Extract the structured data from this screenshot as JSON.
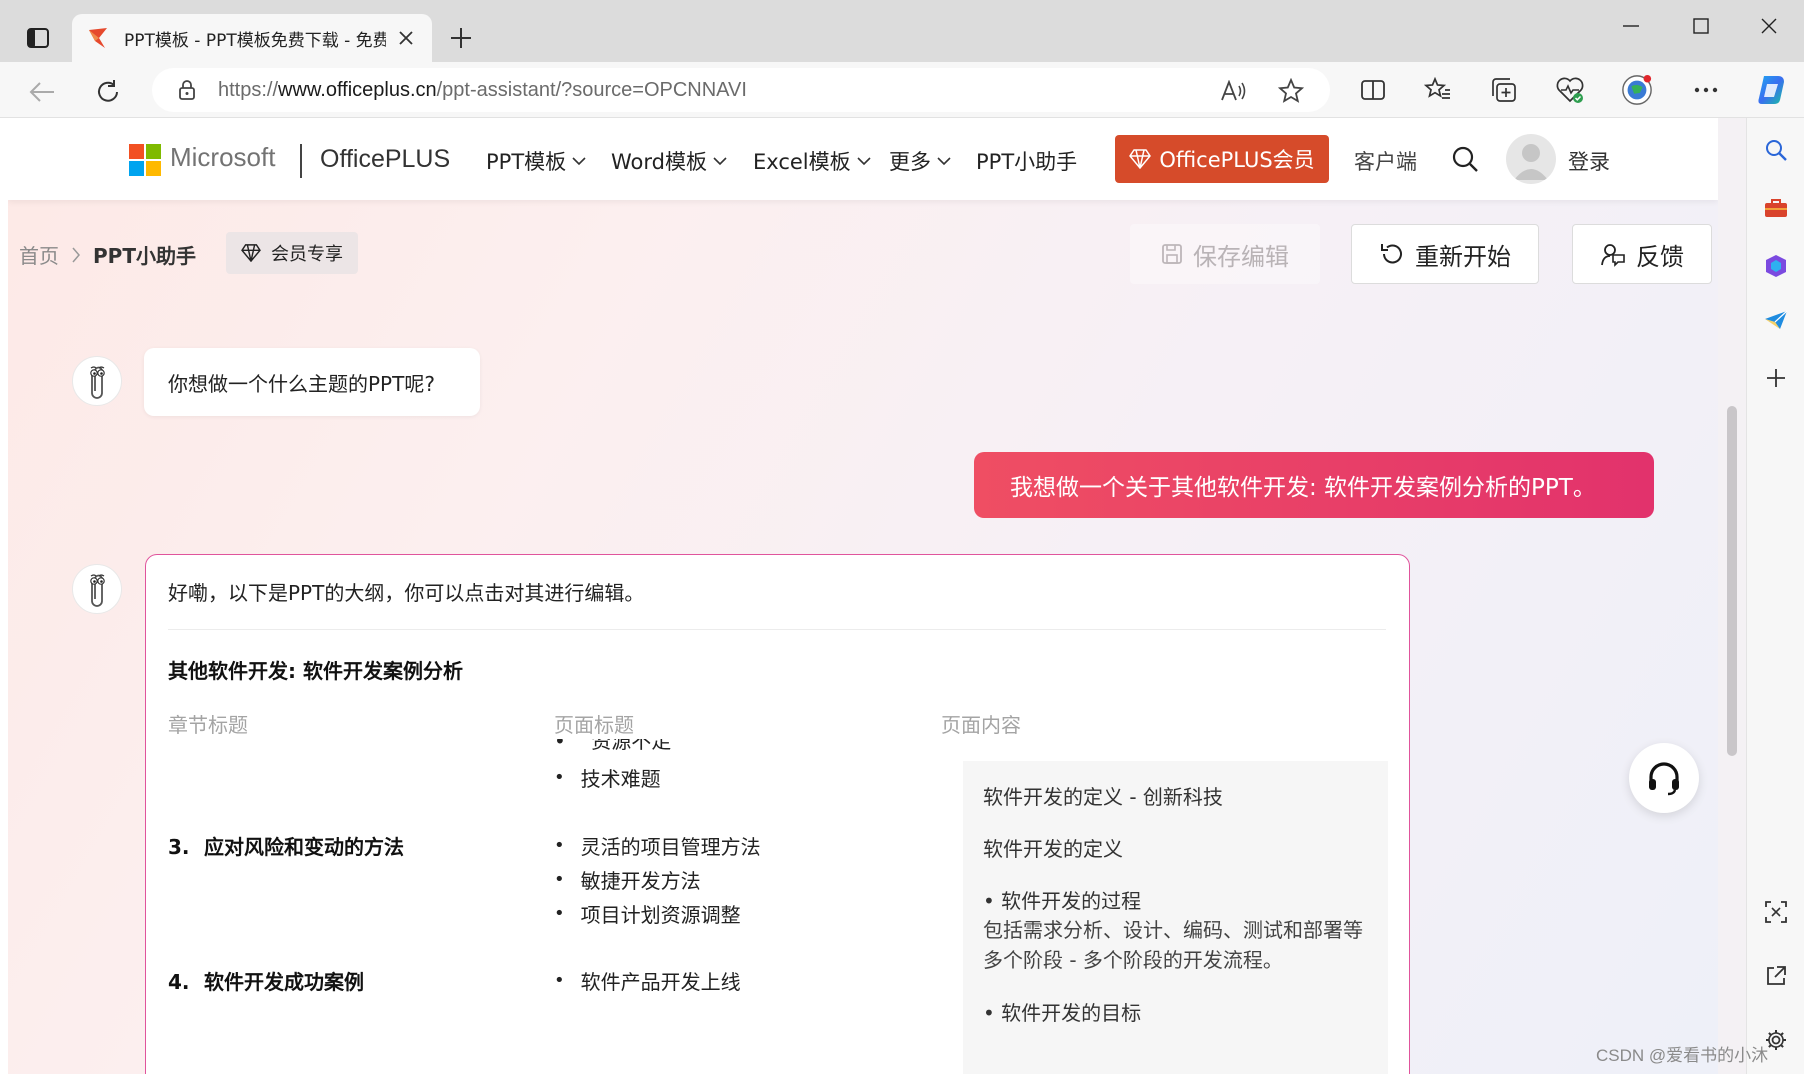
{
  "browser": {
    "tab_title": "PPT模板 - PPT模板免费下载 - 免费",
    "url_prefix": "https://",
    "url_host": "www.officeplus.cn",
    "url_path": "/ppt-assistant/?source=OPCNNAVI"
  },
  "header": {
    "brand_microsoft": "Microsoft",
    "brand_officeplus": "OfficePLUS",
    "nav": [
      "PPT模板",
      "Word模板",
      "Excel模板",
      "更多",
      "PPT小助手"
    ],
    "vip_label": "OfficePLUS会员",
    "client_label": "客户端",
    "login_label": "登录"
  },
  "breadcrumb": {
    "home": "首页",
    "current": "PPT小助手",
    "member_tag": "会员专享"
  },
  "actions": {
    "save": "保存编辑",
    "restart": "重新开始",
    "feedback": "反馈"
  },
  "chat": {
    "bot_question": "你想做一个什么主题的PPT呢?",
    "user_message": "我想做一个关于其他软件开发: 软件开发案例分析的PPT。",
    "bot_reply": "好嘞，以下是PPT的大纲，你可以点击对其进行编辑。"
  },
  "outline": {
    "title": "其他软件开发: 软件开发案例分析",
    "columns": [
      "章节标题",
      "页面标题",
      "页面内容"
    ],
    "cut_item": "资源不足",
    "prev_items": [
      "技术难题"
    ],
    "sections": [
      {
        "num": "3.",
        "title": "应对风险和变动的方法",
        "items": [
          "灵活的项目管理方法",
          "敏捷开发方法",
          "项目计划资源调整"
        ]
      },
      {
        "num": "4.",
        "title": "软件开发成功案例",
        "items": [
          "软件产品开发上线"
        ]
      }
    ],
    "content": {
      "heading": "软件开发的定义 - 创新科技",
      "sub": "软件开发的定义",
      "point1": "• 软件开发的过程",
      "para1": "包括需求分析、设计、编码、测试和部署等多个阶段 - 多个阶段的开发流程。",
      "point2": "• 软件开发的目标"
    }
  },
  "watermark": "CSDN @爱看书的小沐",
  "colors": {
    "vip": "#d64b2a",
    "user_bubble": "#e2326c",
    "card_border": "#e0549c"
  }
}
